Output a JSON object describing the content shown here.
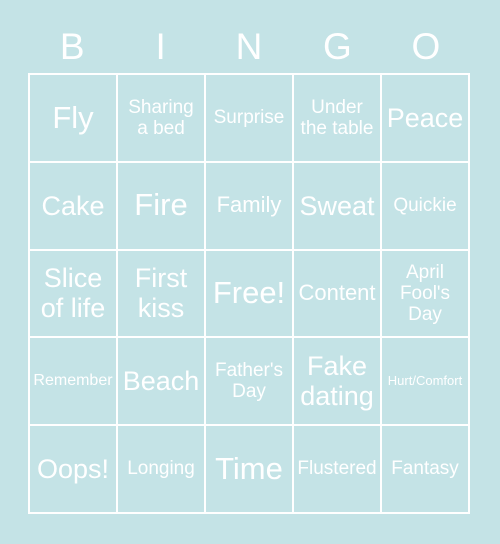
{
  "header": {
    "letters": [
      "B",
      "I",
      "N",
      "G",
      "O"
    ]
  },
  "colors": {
    "background": "#c4e3e6",
    "cell_fill": "#c4e3e6",
    "gridline": "#ffffff",
    "text": "#ffffff"
  },
  "grid": {
    "rows": 5,
    "columns": 5,
    "cells": [
      [
        {
          "label": "Fly",
          "size": "fs-xl"
        },
        {
          "label": "Sharing a bed",
          "size": "fs-sm"
        },
        {
          "label": "Surprise",
          "size": "fs-sm"
        },
        {
          "label": "Under the table",
          "size": "fs-sm"
        },
        {
          "label": "Peace",
          "size": "fs-lg"
        }
      ],
      [
        {
          "label": "Cake",
          "size": "fs-lg"
        },
        {
          "label": "Fire",
          "size": "fs-xl"
        },
        {
          "label": "Family",
          "size": "fs-md"
        },
        {
          "label": "Sweat",
          "size": "fs-lg"
        },
        {
          "label": "Quickie",
          "size": "fs-sm"
        }
      ],
      [
        {
          "label": "Slice of life",
          "size": "fs-lg"
        },
        {
          "label": "First kiss",
          "size": "fs-lg"
        },
        {
          "label": "Free!",
          "size": "fs-xl"
        },
        {
          "label": "Content",
          "size": "fs-md"
        },
        {
          "label": "April Fool's Day",
          "size": "fs-sm"
        }
      ],
      [
        {
          "label": "Remember",
          "size": "fs-xs"
        },
        {
          "label": "Beach",
          "size": "fs-lg"
        },
        {
          "label": "Father's Day",
          "size": "fs-sm"
        },
        {
          "label": "Fake dating",
          "size": "fs-lg"
        },
        {
          "label": "Hurt/Comfort",
          "size": "fs-xxs"
        }
      ],
      [
        {
          "label": "Oops!",
          "size": "fs-lg"
        },
        {
          "label": "Longing",
          "size": "fs-sm"
        },
        {
          "label": "Time",
          "size": "fs-xl"
        },
        {
          "label": "Flustered",
          "size": "fs-sm"
        },
        {
          "label": "Fantasy",
          "size": "fs-sm"
        }
      ]
    ]
  }
}
